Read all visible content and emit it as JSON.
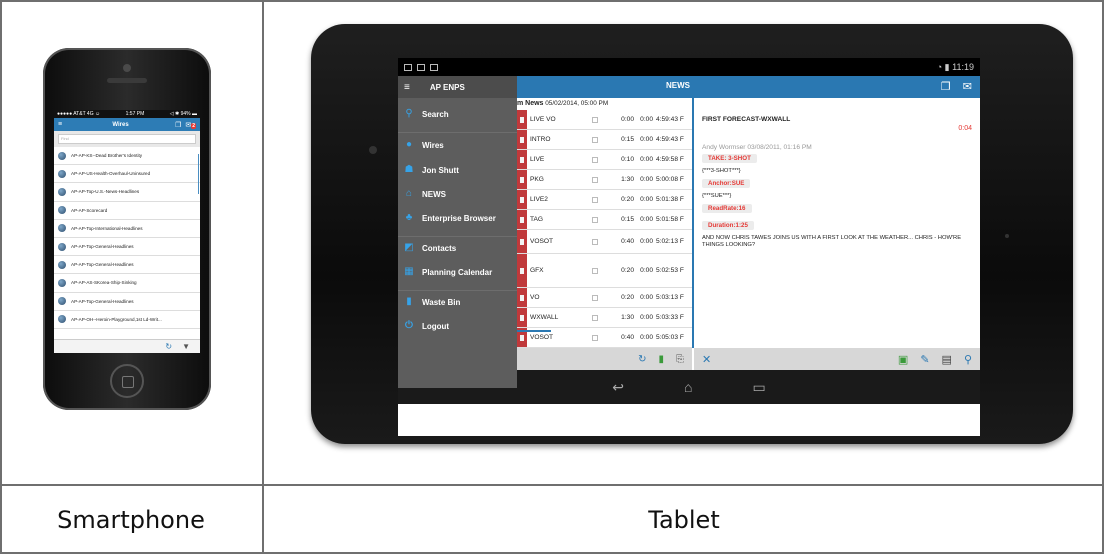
{
  "captions": {
    "phone": "Smartphone",
    "tablet": "Tablet"
  },
  "colors": {
    "accent": "#2a78b2",
    "urgent": "#e53935",
    "tag": "#c0393b",
    "drawer": "#5d5d5d"
  },
  "phone": {
    "status": {
      "carrier": "●●●●● AT&T  4G  ☺",
      "time": "1:57 PM",
      "battery": "◁ ✱ 94% ▬"
    },
    "nav": {
      "title": "Wires",
      "badge": "2"
    },
    "search_placeholder": "Find",
    "items": [
      "AP-AP-KS--Dead Brother's Identity",
      "AP-AP-US-Health-Overhaul-Uninsured",
      "AP-AP-Top-U.S.-News-Headlines",
      "AP-AP-Scorecard",
      "AP-AP-Top-International-Headlines",
      "AP-AP-Top-General-Headlines",
      "AP-AP-Top-General-Headlines",
      "AP-AP-AS-SKorea-Ship-Sinking",
      "AP-AP-Top-General-Headlines",
      "AP-AP-OH--Heroin-Playground,1st Ld-Writ..."
    ],
    "toolbar": {
      "refresh_icon": "refresh-icon",
      "filter_icon": "filter-icon"
    }
  },
  "tablet": {
    "status_time": "11:19",
    "app_title": "AP ENPS",
    "header_title": "NEWS",
    "drawer": [
      {
        "label": "Search",
        "icon": "search-icon"
      },
      {
        "label": "Wires",
        "icon": "globe-icon"
      },
      {
        "label": "Jon Shutt",
        "icon": "user-icon"
      },
      {
        "label": "NEWS",
        "icon": "home-icon"
      },
      {
        "label": "Enterprise Browser",
        "icon": "network-icon"
      },
      {
        "label": "Contacts",
        "icon": "contacts-icon"
      },
      {
        "label": "Planning Calendar",
        "icon": "calendar-icon"
      },
      {
        "label": "Waste Bin",
        "icon": "trash-icon"
      },
      {
        "label": "Logout",
        "icon": "power-icon"
      }
    ],
    "rundown": {
      "header_title": "m News",
      "header_date": "05/02/2014, 05:00 PM",
      "rows": [
        {
          "slug": "LIVE VO",
          "est": "0:00",
          "act": "0:00",
          "time": "4:59:43 F"
        },
        {
          "slug": "INTRO",
          "est": "0:15",
          "act": "0:00",
          "time": "4:59:43 F"
        },
        {
          "slug": "LIVE",
          "est": "0:10",
          "act": "0:00",
          "time": "4:59:58 F"
        },
        {
          "slug": "PKG",
          "est": "1:30",
          "act": "0:00",
          "time": "5:00:08 F"
        },
        {
          "slug": "LIVE2",
          "est": "0:20",
          "act": "0:00",
          "time": "5:01:38 F"
        },
        {
          "slug": "TAG",
          "est": "0:15",
          "act": "0:00",
          "time": "5:01:58 F"
        },
        {
          "slug": "VOSOT",
          "est": "0:40",
          "act": "0:00",
          "time": "5:02:13 F"
        },
        {
          "slug": "GFX",
          "est": "0:20",
          "act": "0:00",
          "time": "5:02:53 F"
        },
        {
          "slug": "VO",
          "est": "0:20",
          "act": "0:00",
          "time": "5:03:13 F"
        },
        {
          "slug": "WXWALL",
          "est": "1:30",
          "act": "0:00",
          "time": "5:03:33 F"
        },
        {
          "slug": "VOSOT",
          "est": "0:40",
          "act": "0:00",
          "time": "5:05:03 F"
        }
      ]
    },
    "story": {
      "title": "FIRST FORECAST-WXWALL",
      "duration": "0:04",
      "author": "Andy Wormser  03/08/2011, 01:16 PM",
      "take": "TAKE: 3-SHOT",
      "take_line": "{***3-SHOT***}",
      "anchor": "Anchor:SUE",
      "anchor_line": "{***SUE***}",
      "readrate": "ReadRate:16",
      "duration_pill": "Duration:1:25",
      "body": "AND NOW CHRIS TAWES JOINS US WITH A FIRST LOOK AT THE WEATHER... CHRIS - HOW'RE THINGS LOOKING?"
    }
  }
}
